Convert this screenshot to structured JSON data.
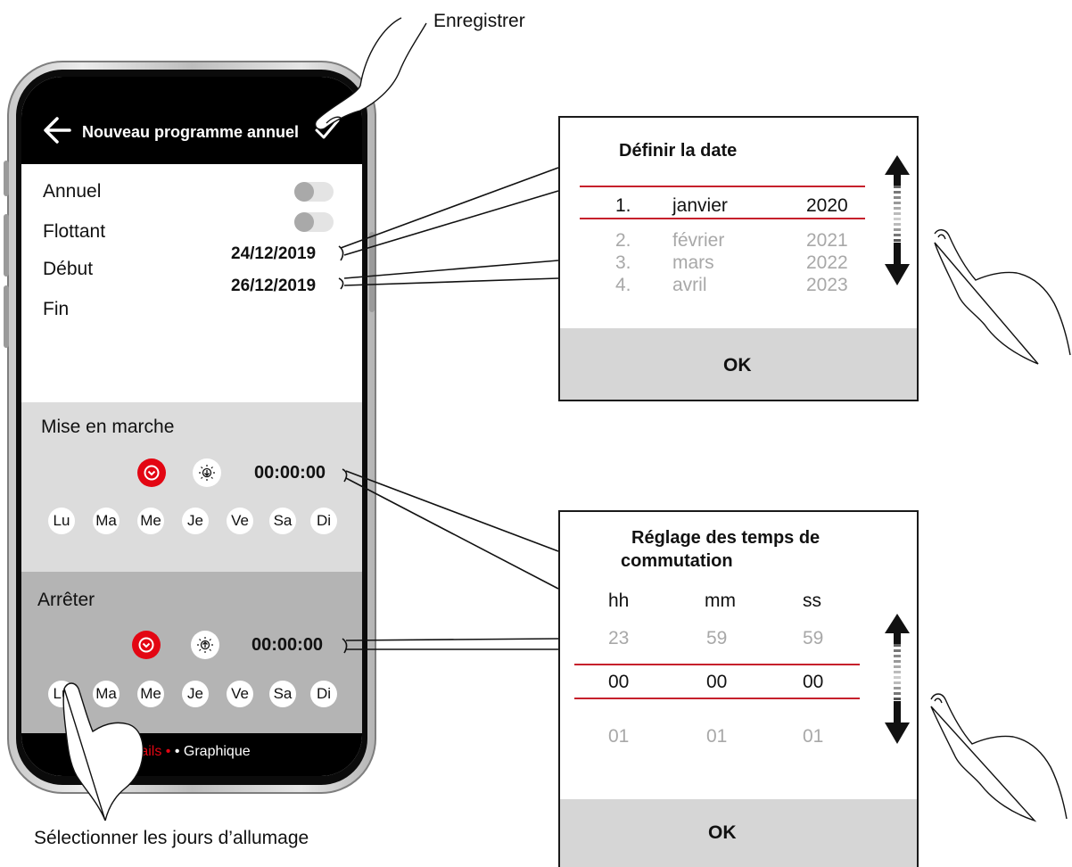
{
  "callouts": {
    "save": "Enregistrer",
    "select_days": "Sélectionner les jours d’allumage"
  },
  "phone": {
    "header": {
      "title": "Nouveau programme annuel"
    },
    "rows": [
      {
        "label": "Annuel"
      },
      {
        "label": "Flottant"
      },
      {
        "label": "Début",
        "value": "24/12/2019"
      },
      {
        "label": "Fin",
        "value": "26/12/2019"
      }
    ],
    "start": {
      "title": "Mise en marche",
      "time": "00:00:00",
      "days": [
        "Lu",
        "Ma",
        "Me",
        "Je",
        "Ve",
        "Sa",
        "Di"
      ]
    },
    "stop": {
      "title": "Arrêter",
      "time": "00:00:00",
      "days": [
        "Lu",
        "Ma",
        "Me",
        "Je",
        "Ve",
        "Sa",
        "Di"
      ]
    },
    "tabs": {
      "details": "étails",
      "sep": " • ",
      "graph": "• Graphique"
    }
  },
  "date_dialog": {
    "title": "Définir la date",
    "selected": {
      "day": "1.",
      "month": "janvier",
      "year": "2020"
    },
    "next": [
      {
        "day": "2.",
        "month": "février",
        "year": "2021"
      },
      {
        "day": "3.",
        "month": "mars",
        "year": "2022"
      },
      {
        "day": "4.",
        "month": "avril",
        "year": "2023"
      }
    ],
    "ok": "OK"
  },
  "time_dialog": {
    "title_line1": "Réglage des temps de",
    "title_line2": "commutation",
    "headers": {
      "hh": "hh",
      "mm": "mm",
      "ss": "ss"
    },
    "prev": {
      "hh": "23",
      "mm": "59",
      "ss": "59"
    },
    "selected": {
      "hh": "00",
      "mm": "00",
      "ss": "00"
    },
    "next": {
      "hh": "01",
      "mm": "01",
      "ss": "01"
    },
    "ok": "OK"
  },
  "colors": {
    "accent": "#e30613",
    "line": "#c6202c"
  }
}
